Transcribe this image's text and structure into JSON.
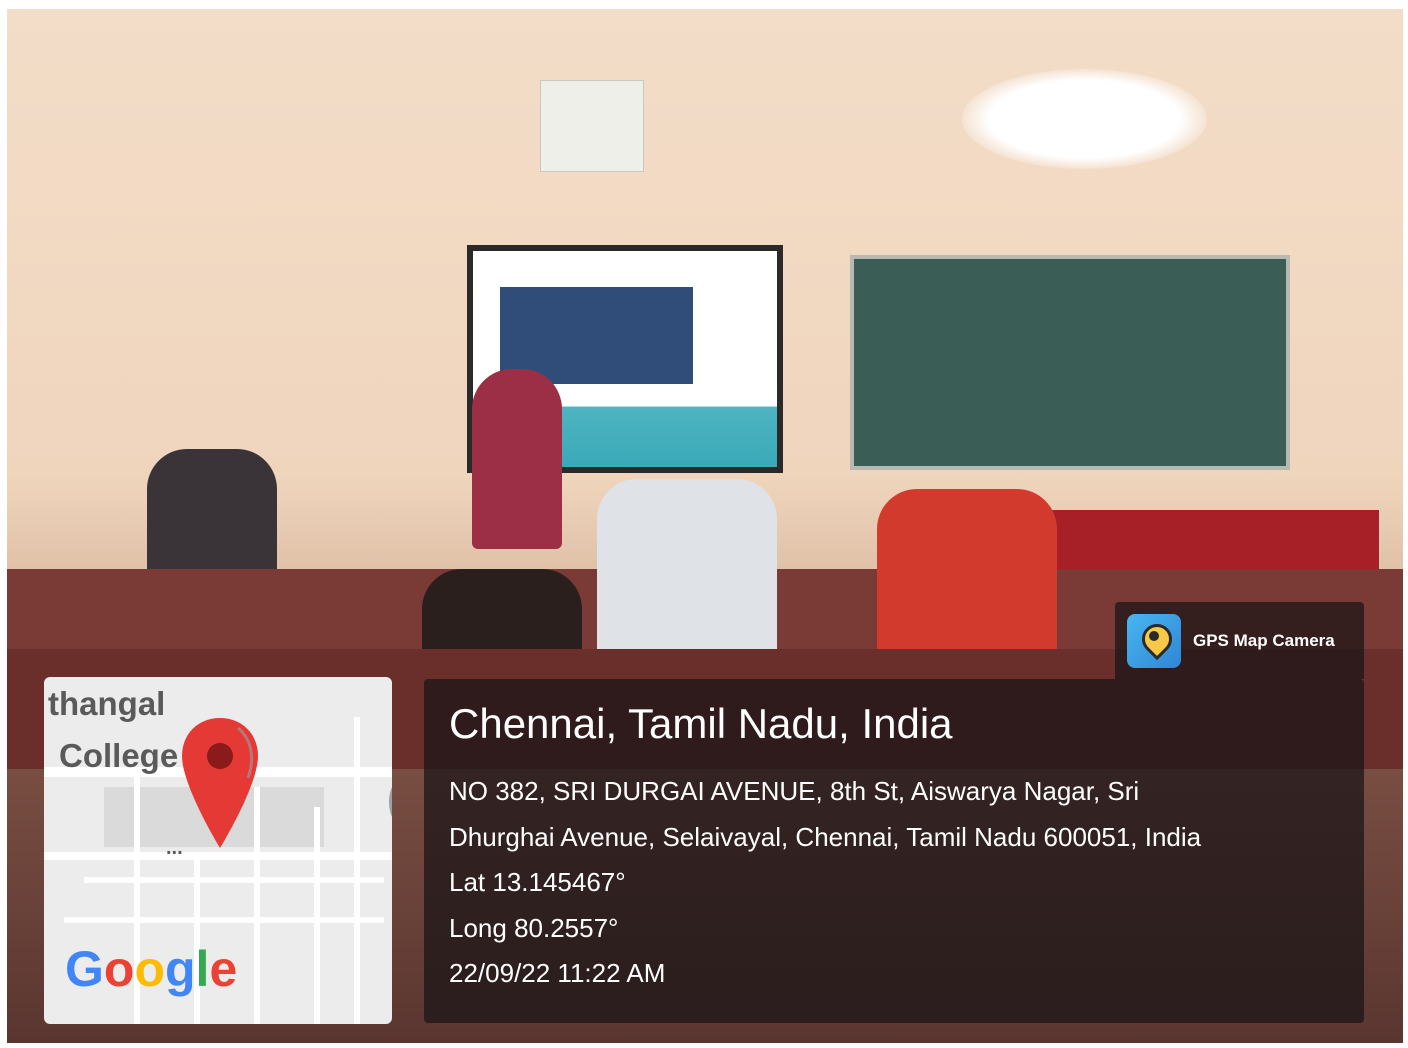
{
  "badge": {
    "label": "GPS Map Camera",
    "icon": "gps-map-camera-icon"
  },
  "location": {
    "city": "Chennai, Tamil Nadu, India",
    "address_line1": "NO 382, SRI DURGAI AVENUE, 8th St, Aiswarya Nagar, Sri",
    "address_line2": "Dhurghai Avenue, Selaivayal, Chennai, Tamil Nadu 600051, India",
    "lat": "Lat 13.145467°",
    "long": "Long 80.2557°",
    "datetime": "22/09/22 11:22 AM"
  },
  "map": {
    "label1": "thangal",
    "label2": "College",
    "dots": "...",
    "brand": "Google",
    "pin_color": "#e53935"
  },
  "colors": {
    "overlay": "#191416",
    "google_blue": "#4285f4",
    "google_red": "#ea4335",
    "google_yellow": "#fbbc05",
    "google_green": "#34a853"
  }
}
